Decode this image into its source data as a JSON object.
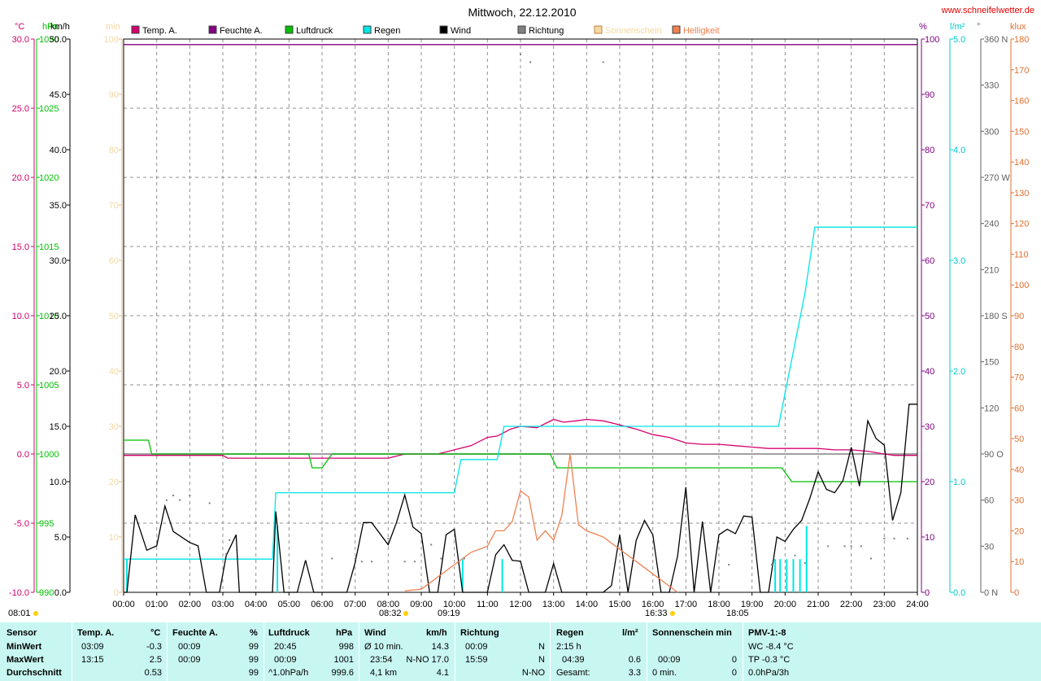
{
  "chart_data": {
    "type": "line",
    "title": "Mittwoch, 22.12.2010",
    "website": "www.schneifelwetter.de",
    "grid": true,
    "x_ticks": [
      "00:00",
      "01:00",
      "02:00",
      "03:00",
      "04:00",
      "05:00",
      "06:00",
      "07:00",
      "08:00",
      "09:00",
      "10:00",
      "11:00",
      "12:00",
      "13:00",
      "14:00",
      "15:00",
      "16:00",
      "17:00",
      "18:00",
      "19:00",
      "20:00",
      "21:00",
      "22:00",
      "23:00",
      "24:00"
    ],
    "x_range_hours": [
      0,
      24
    ],
    "axes": {
      "temp": {
        "unit": "°C",
        "range": [
          -10,
          30
        ],
        "ticks": [
          "30.0",
          "25.0",
          "20.0",
          "15.0",
          "10.0",
          "5.0",
          "0.0",
          "-5.0",
          "-10.0"
        ],
        "color": "#d4006e"
      },
      "pressure": {
        "unit": "hPa",
        "range": [
          990,
          1030
        ],
        "ticks": [
          "1030",
          "1025",
          "1020",
          "1015",
          "1010",
          "1005",
          "1000",
          "995",
          "990"
        ],
        "color": "#00c000"
      },
      "wind": {
        "unit": "km/h",
        "range": [
          0,
          50
        ],
        "ticks": [
          "50.0",
          "45.0",
          "40.0",
          "35.0",
          "30.0",
          "25.0",
          "20.0",
          "15.0",
          "10.0",
          "5.0",
          "0.0"
        ],
        "color": "#000000"
      },
      "sun_min": {
        "unit": "min",
        "range": [
          0,
          100
        ],
        "ticks": [
          "100",
          "90",
          "80",
          "70",
          "60",
          "50",
          "40",
          "30",
          "20",
          "10",
          "0"
        ],
        "color": "#f5d7a0"
      },
      "humidity": {
        "unit": "%",
        "range": [
          0,
          100
        ],
        "ticks": [
          "100",
          "90",
          "80",
          "70",
          "60",
          "50",
          "40",
          "30",
          "20",
          "10",
          "0"
        ],
        "color": "#800080"
      },
      "rain": {
        "unit": "l/m²",
        "range": [
          0,
          5
        ],
        "ticks": [
          "5.0",
          "4.0",
          "3.0",
          "2.0",
          "1.0",
          "0.0"
        ],
        "color": "#00c8c8"
      },
      "direction": {
        "unit": "°",
        "range": [
          0,
          360
        ],
        "ticks": [
          "360 N",
          "330",
          "300",
          "270 W",
          "240",
          "210",
          "180 S",
          "150",
          "120",
          "90 O",
          "60",
          "30",
          "0 N"
        ],
        "color": "#606060"
      },
      "brightness": {
        "unit": "klux",
        "range": [
          0,
          180
        ],
        "ticks": [
          "180",
          "170",
          "160",
          "150",
          "140",
          "130",
          "120",
          "110",
          "100",
          "90",
          "80",
          "70",
          "60",
          "50",
          "40",
          "30",
          "20",
          "10",
          "0"
        ],
        "color": "#e07030"
      }
    },
    "legend": [
      {
        "name": "Temp. A.",
        "color": "#d4006e"
      },
      {
        "name": "Feuchte A.",
        "color": "#800080"
      },
      {
        "name": "Luftdruck",
        "color": "#00c000"
      },
      {
        "name": "Regen",
        "color": "#00e5e5"
      },
      {
        "name": "Wind",
        "color": "#000000"
      },
      {
        "name": "Richtung",
        "color": "#808080"
      },
      {
        "name": "Sonnenschein",
        "color": "#f5d7a0"
      },
      {
        "name": "Helligkeit",
        "color": "#f08050"
      }
    ],
    "series": [
      {
        "name": "Temp. A.",
        "axis": "temp",
        "color": "#d4006e",
        "x": [
          0,
          3.0,
          3.15,
          8,
          8.5,
          9.0,
          9.5,
          10,
          10.5,
          11,
          11.3,
          11.7,
          12,
          12.5,
          13,
          13.3,
          13.7,
          14,
          14.5,
          15,
          15.5,
          16,
          16.5,
          17,
          17.5,
          18,
          18.5,
          19,
          19.5,
          20,
          20.5,
          21,
          21.5,
          22,
          22.5,
          23,
          23.3,
          24
        ],
        "y": [
          -0.1,
          -0.1,
          -0.3,
          -0.3,
          0.0,
          0.0,
          0.0,
          0.3,
          0.6,
          1.2,
          1.3,
          1.8,
          2.0,
          1.9,
          2.5,
          2.3,
          2.4,
          2.5,
          2.4,
          2.1,
          1.8,
          1.4,
          1.2,
          0.8,
          0.7,
          0.7,
          0.6,
          0.5,
          0.4,
          0.4,
          0.4,
          0.4,
          0.3,
          0.3,
          0.2,
          0.0,
          -0.1,
          -0.1
        ]
      },
      {
        "name": "Feuchte A.",
        "axis": "humidity",
        "color": "#800080",
        "x": [
          0,
          24
        ],
        "y": [
          99,
          99
        ]
      },
      {
        "name": "Luftdruck",
        "axis": "pressure",
        "color": "#00c000",
        "x": [
          0,
          0.75,
          0.85,
          5.6,
          5.7,
          6.0,
          6.3,
          12.9,
          13.1,
          19.9,
          20.2,
          24
        ],
        "y": [
          1001,
          1001,
          1000,
          1000,
          999,
          999,
          1000,
          1000,
          999,
          999,
          998,
          998
        ]
      },
      {
        "name": "Regen",
        "axis": "rain",
        "color": "#00e5e5",
        "x": [
          0,
          4.5,
          4.6,
          10.0,
          10.2,
          11.3,
          11.5,
          19.8,
          20.6,
          20.9,
          24
        ],
        "y": [
          0.3,
          0.3,
          0.9,
          0.9,
          1.2,
          1.2,
          1.5,
          1.5,
          2.7,
          3.3,
          3.3
        ]
      },
      {
        "name": "Regen (Menge)",
        "axis": "rain",
        "color": "#00e5e5",
        "kind": "bars",
        "x": [
          0.1,
          4.65,
          10.25,
          11.45,
          19.7,
          19.85,
          20.05,
          20.25,
          20.45,
          20.65
        ],
        "y": [
          0.3,
          0.6,
          0.3,
          0.3,
          0.3,
          0.3,
          0.3,
          0.3,
          0.3,
          0.6
        ]
      },
      {
        "name": "Wind",
        "axis": "wind",
        "color": "#000000",
        "x": [
          0,
          0.1,
          0.35,
          0.7,
          1.0,
          1.25,
          1.5,
          2.0,
          2.25,
          2.5,
          2.9,
          3.1,
          3.4,
          3.5,
          4.0,
          4.5,
          4.6,
          4.85,
          5.0,
          5.25,
          5.5,
          5.75,
          6.0,
          6.5,
          6.75,
          7.0,
          7.25,
          7.5,
          8.0,
          8.25,
          8.5,
          8.75,
          9.0,
          9.25,
          9.5,
          9.75,
          10.0,
          10.25,
          10.5,
          11.0,
          11.25,
          11.5,
          11.75,
          12.0,
          12.25,
          12.5,
          12.75,
          13.0,
          13.25,
          13.5,
          14.0,
          14.25,
          14.5,
          14.75,
          15.0,
          15.25,
          15.5,
          15.75,
          16.0,
          16.25,
          16.5,
          16.75,
          17.0,
          17.25,
          17.5,
          17.75,
          18.0,
          18.25,
          18.5,
          18.75,
          19.0,
          19.25,
          19.5,
          19.75,
          20.0,
          20.25,
          20.5,
          20.75,
          21.0,
          21.25,
          21.5,
          21.75,
          22.0,
          22.25,
          22.5,
          22.75,
          23.0,
          23.25,
          23.5,
          23.75,
          24.0
        ],
        "y": [
          0,
          0,
          7,
          3.8,
          4.2,
          7.8,
          5.5,
          4.5,
          4.2,
          0,
          0,
          3.3,
          5.2,
          0,
          0,
          0,
          7.3,
          0,
          0,
          0,
          2.9,
          0,
          0,
          0,
          0,
          2.7,
          6.3,
          6.3,
          4.3,
          6.3,
          8.8,
          5.9,
          5.3,
          0,
          0,
          5.2,
          5.7,
          0,
          0,
          0,
          3.4,
          4.3,
          2.9,
          2.8,
          0,
          0,
          0,
          2.6,
          0,
          0,
          0,
          0,
          0,
          0.6,
          5.2,
          0,
          4.7,
          6.5,
          5.2,
          0,
          0,
          3.3,
          9.5,
          0,
          6.4,
          0,
          5.2,
          5.7,
          5.3,
          6.9,
          6.8,
          0,
          0,
          5.0,
          4.6,
          5.7,
          6.5,
          8.5,
          10.9,
          9.3,
          9.0,
          10.1,
          13.1,
          9.6,
          15.5,
          13.9,
          13.3,
          6.5,
          9.0,
          17.0,
          17.0
        ]
      },
      {
        "name": "Helligkeit",
        "axis": "brightness",
        "color": "#f08050",
        "x": [
          8.5,
          9.0,
          9.5,
          10.0,
          10.5,
          11.0,
          11.25,
          11.5,
          11.75,
          12.0,
          12.25,
          12.5,
          12.75,
          13.0,
          13.25,
          13.5,
          13.75,
          14.0,
          14.5,
          15.0,
          15.5,
          16.0,
          16.5,
          16.75
        ],
        "y": [
          0.5,
          1,
          5,
          9,
          13,
          15,
          20,
          20,
          23,
          33,
          31,
          17,
          20,
          17,
          25,
          45,
          22,
          20,
          18,
          14,
          10,
          6,
          2,
          0
        ]
      },
      {
        "name": "Richtung",
        "axis": "direction",
        "color": "#808080",
        "kind": "dots",
        "x": [
          1.3,
          1.5,
          1.7,
          2.0,
          2.6,
          3.1,
          3.2,
          6.3,
          7.0,
          7.2,
          7.5,
          8.0,
          8.5,
          8.8,
          9.3,
          9.6,
          10.3,
          12.0,
          12.3,
          14.5,
          15.0,
          15.5,
          16.5,
          17.3,
          18.3,
          19.6,
          20.3,
          20.6,
          21.3,
          21.8,
          22.0,
          22.3,
          22.6,
          23.0,
          23.3,
          23.7,
          24.0
        ],
        "y": [
          60,
          63,
          60,
          63,
          58,
          25,
          34,
          22,
          22,
          20,
          20,
          35,
          20,
          20,
          31,
          22,
          22,
          350,
          345,
          345,
          360,
          360,
          360,
          360,
          18,
          18,
          24,
          19,
          30,
          30,
          30,
          30,
          22,
          35,
          35,
          35,
          38
        ]
      }
    ],
    "sun_marks": {
      "sunrise": "08:01",
      "first_sun": "08:32",
      "peak": "09:19",
      "last_sun": "16:33",
      "sunset": "18:05"
    }
  },
  "stats": {
    "header": {
      "sensor": "Sensor",
      "temp": "Temp. A.",
      "temp_unit": "°C",
      "humid": "Feuchte A.",
      "humid_unit": "%",
      "press": "Luftdruck",
      "press_unit": "hPa",
      "wind": "Wind",
      "wind_unit": "km/h",
      "dir": "Richtung",
      "rain": "Regen",
      "rain_unit": "l/m²",
      "sun": "Sonnenschein min",
      "pmv": "PMV-1:-8"
    },
    "rows": {
      "min": {
        "label": "MinWert",
        "temp_time": "03:09",
        "temp_val": "-0.3",
        "humid_time": "00:09",
        "humid_val": "99",
        "press_time": "20:45",
        "press_val": "998",
        "wind_label": "Ø 10 min.",
        "wind_val": "14.3",
        "dir_time": "00:09",
        "dir_val": "N",
        "rain_label": "2:15 h",
        "rain_val": "",
        "sun_label": "",
        "sun_val": "",
        "pmv": "WC -8.4 °C"
      },
      "max": {
        "label": "MaxWert",
        "temp_time": "13:15",
        "temp_val": "2.5",
        "humid_time": "00:09",
        "humid_val": "99",
        "press_time": "00:09",
        "press_val": "1001",
        "wind_label": "23:54",
        "wind_val": "N-NO 17.0",
        "dir_time": "15:59",
        "dir_val": "N",
        "rain_label": "04:39",
        "rain_val": "0.6",
        "sun_label": "00:09",
        "sun_val": "0",
        "pmv": "TP -0.3 °C"
      },
      "avg": {
        "label": "Durchschnitt",
        "temp_time": "",
        "temp_val": "0.53",
        "humid_time": "",
        "humid_val": "99",
        "press_time": "^1.0hPa/h",
        "press_val": "999.6",
        "wind_label": "4,1 km",
        "wind_val": "4.1",
        "dir_time": "",
        "dir_val": "N-NO",
        "rain_label": "Gesamt:",
        "rain_val": "3.3",
        "sun_label": "0 min.",
        "sun_val": "0",
        "pmv": "0.0hPa/3h"
      }
    }
  }
}
